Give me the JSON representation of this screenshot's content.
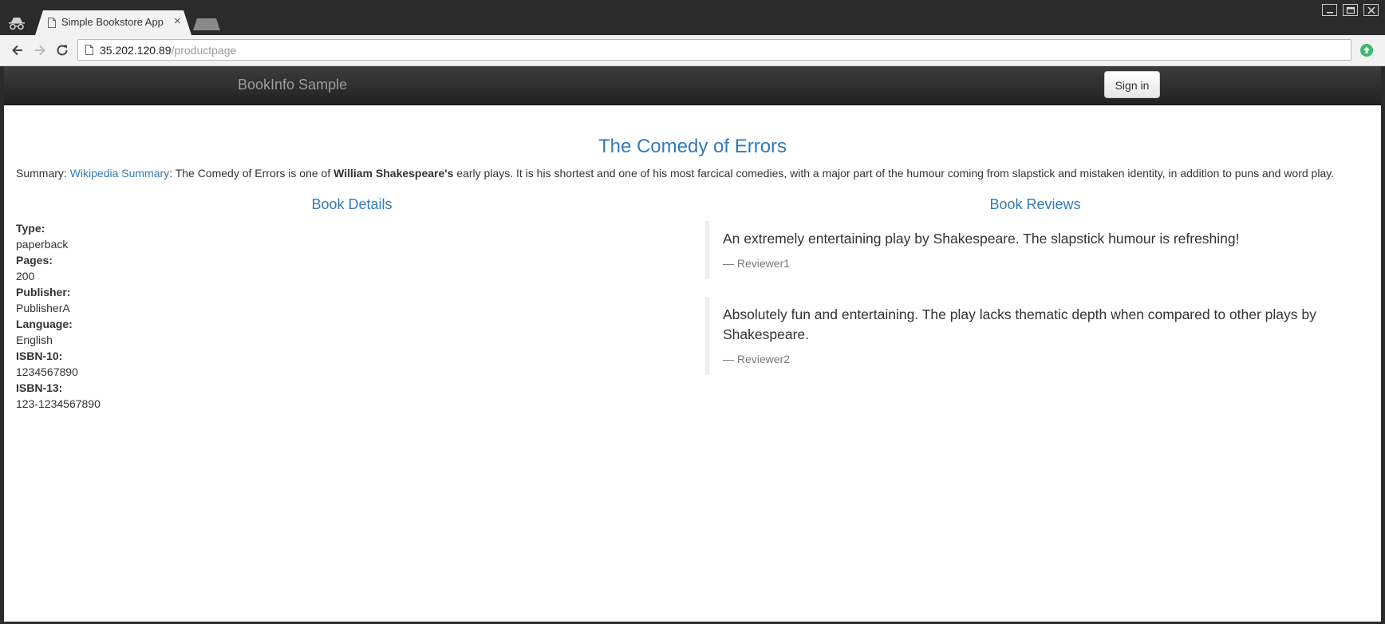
{
  "browser": {
    "tab_title": "Simple Bookstore App",
    "tab_close": "×",
    "url_host": "35.202.120.89",
    "url_path": "/productpage"
  },
  "app": {
    "brand": "BookInfo Sample",
    "signin_label": "Sign in"
  },
  "book": {
    "title": "The Comedy of Errors",
    "summary_prefix": "Summary: ",
    "summary_link": "Wikipedia Summary",
    "summary_part1": ": The Comedy of Errors is one of ",
    "summary_bold": "William Shakespeare's",
    "summary_part2": " early plays. It is his shortest and one of his most farcical comedies, with a major part of the humour coming from slapstick and mistaken identity, in addition to puns and word play."
  },
  "details": {
    "heading": "Book Details",
    "items": [
      {
        "label": "Type:",
        "value": "paperback"
      },
      {
        "label": "Pages:",
        "value": "200"
      },
      {
        "label": "Publisher:",
        "value": "PublisherA"
      },
      {
        "label": "Language:",
        "value": "English"
      },
      {
        "label": "ISBN-10:",
        "value": "1234567890"
      },
      {
        "label": "ISBN-13:",
        "value": "123-1234567890"
      }
    ]
  },
  "reviews": {
    "heading": "Book Reviews",
    "items": [
      {
        "text": "An extremely entertaining play by Shakespeare. The slapstick humour is refreshing!",
        "author": "— Reviewer1"
      },
      {
        "text": "Absolutely fun and entertaining. The play lacks thematic depth when compared to other plays by Shakespeare.",
        "author": "— Reviewer2"
      }
    ]
  },
  "colors": {
    "link": "#337ab7",
    "navbar": "#222222",
    "chrome": "#2b2b2b"
  }
}
